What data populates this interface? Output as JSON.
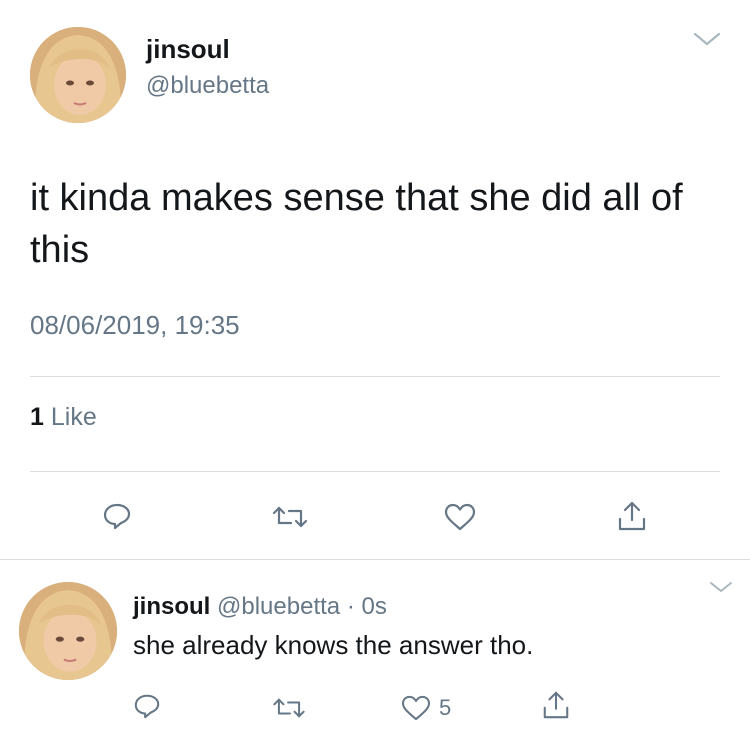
{
  "main_tweet": {
    "display_name": "jinsoul",
    "handle": "@bluebetta",
    "text": "it kinda makes sense that she did all of this",
    "timestamp": "08/06/2019, 19:35",
    "likes_count": "1",
    "likes_label": "Like"
  },
  "reply_tweet": {
    "display_name": "jinsoul",
    "handle": "@bluebetta",
    "separator": "·",
    "time": "0s",
    "text": "she already knows the answer tho.",
    "like_count": "5"
  },
  "icons": {
    "menu": "chevron-down-icon",
    "reply": "speech-bubble-icon",
    "retweet": "retweet-icon",
    "like": "heart-icon",
    "share": "share-icon"
  },
  "colors": {
    "text": "#14171a",
    "secondary": "#657786",
    "divider": "#d9dde0"
  }
}
